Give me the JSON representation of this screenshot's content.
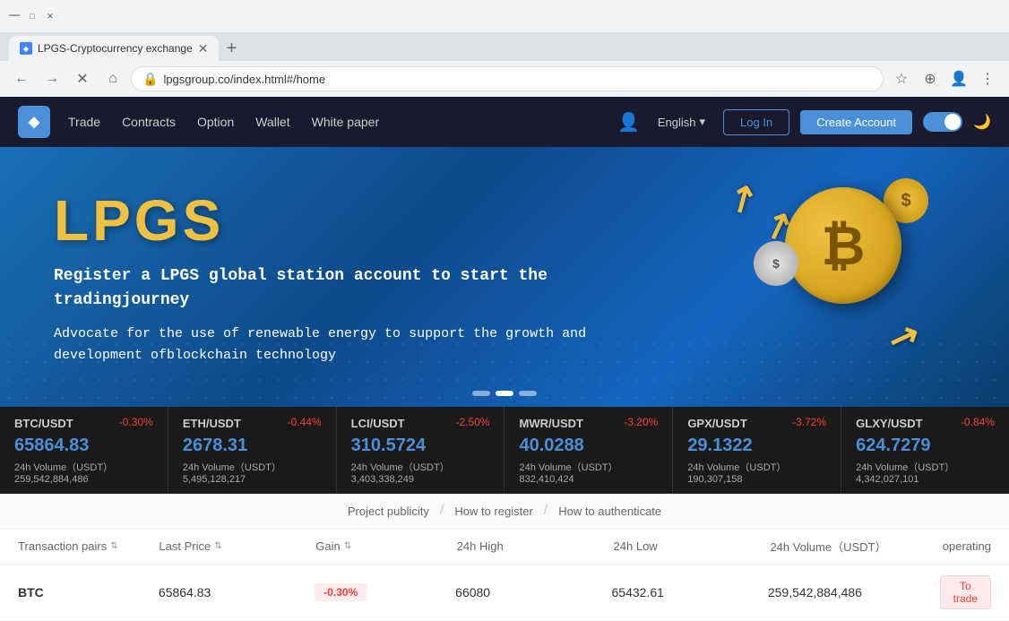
{
  "browser": {
    "tab_title": "LPGS-Cryptocurrency exchange",
    "url": "lpgsgroup.co/index.html#/home",
    "nav_back": "←",
    "nav_forward": "→",
    "nav_refresh": "✕",
    "nav_home": "⌂"
  },
  "navbar": {
    "logo_text": "◆",
    "links": [
      {
        "label": "Trade",
        "key": "trade"
      },
      {
        "label": "Contracts",
        "key": "contracts"
      },
      {
        "label": "Option",
        "key": "option"
      },
      {
        "label": "Wallet",
        "key": "wallet"
      },
      {
        "label": "White paper",
        "key": "whitepaper"
      }
    ],
    "language": "English",
    "login_label": "Log In",
    "create_label": "Create Account"
  },
  "hero": {
    "title": "LPGS",
    "subtitle": "Register a LPGS global station account to start the tradingjourney",
    "description": "Advocate for the use of renewable energy to support the growth and development ofblockchain technology",
    "btc_symbol": "₿",
    "coin_dollar": "$",
    "coin_s": "◎"
  },
  "ticker": [
    {
      "pair": "BTC/USDT",
      "change": "-0.30%",
      "price": "65864.83",
      "volume_label": "24h Volume（USDT）",
      "volume": "259,542,884,486"
    },
    {
      "pair": "ETH/USDT",
      "change": "-0.44%",
      "price": "2678.31",
      "volume_label": "24h Volume（USDT）",
      "volume": "5,495,128,217"
    },
    {
      "pair": "LCI/USDT",
      "change": "-2.50%",
      "price": "310.5724",
      "volume_label": "24h Volume（USDT）",
      "volume": "3,403,338,249"
    },
    {
      "pair": "MWR/USDT",
      "change": "-3.20%",
      "price": "40.0288",
      "volume_label": "24h Volume（USDT）",
      "volume": "832,410,424"
    },
    {
      "pair": "GPX/USDT",
      "change": "-3.72%",
      "price": "29.1322",
      "volume_label": "24h Volume（USDT）",
      "volume": "190,307,158"
    },
    {
      "pair": "GLXY/USDT",
      "change": "-0.84%",
      "price": "624.7279",
      "volume_label": "24h Volume（USDT）",
      "volume": "4,342,027,101"
    }
  ],
  "subnav": {
    "items": [
      {
        "label": "Project publicity",
        "key": "project"
      },
      {
        "sep": "/"
      },
      {
        "label": "How to register",
        "key": "register"
      },
      {
        "sep": "/"
      },
      {
        "label": "How to authenticate",
        "key": "authenticate"
      }
    ]
  },
  "table": {
    "headers": {
      "pairs": "Transaction pairs",
      "price": "Last Price",
      "gain": "Gain",
      "high": "24h High",
      "low": "24h Low",
      "volume": "24h Volume（USDT）",
      "operating": "operating"
    },
    "rows": [
      {
        "pair": "BTC",
        "price": "65864.83",
        "gain": "-0.30%",
        "gain_type": "neg",
        "high": "66080",
        "low": "65432.61",
        "volume": "259,542,884,486",
        "op_label": "To trade"
      }
    ]
  }
}
